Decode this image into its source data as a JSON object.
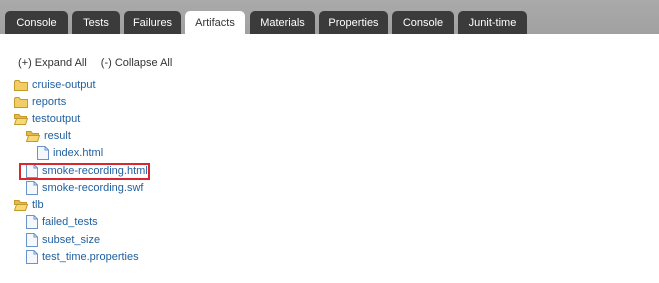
{
  "tabs": [
    {
      "label": "Console",
      "active": false
    },
    {
      "label": "Tests",
      "active": false
    },
    {
      "label": "Failures",
      "active": false
    },
    {
      "label": "Artifacts",
      "active": true
    },
    {
      "label": "Materials",
      "active": false
    },
    {
      "label": "Properties",
      "active": false
    },
    {
      "label": "Console",
      "active": false
    },
    {
      "label": "Junit-time",
      "active": false
    }
  ],
  "toolbar": {
    "expand_all": "(+) Expand All",
    "collapse_all": "(-) Collapse All"
  },
  "tree": [
    {
      "label": "cruise-output",
      "type": "folder",
      "expanded": false,
      "depth": 0
    },
    {
      "label": "reports",
      "type": "folder",
      "expanded": false,
      "depth": 0
    },
    {
      "label": "testoutput",
      "type": "folder",
      "expanded": true,
      "depth": 0
    },
    {
      "label": "result",
      "type": "folder",
      "expanded": true,
      "depth": 1
    },
    {
      "label": "index.html",
      "type": "file",
      "depth": 2
    },
    {
      "label": "smoke-recording.html",
      "type": "file",
      "depth": 1,
      "highlighted": true
    },
    {
      "label": "smoke-recording.swf",
      "type": "file",
      "depth": 1
    },
    {
      "label": "tlb",
      "type": "folder",
      "expanded": true,
      "depth": 0
    },
    {
      "label": "failed_tests",
      "type": "file",
      "depth": 1
    },
    {
      "label": "subset_size",
      "type": "file",
      "depth": 1
    },
    {
      "label": "test_time.properties",
      "type": "file",
      "depth": 1
    }
  ],
  "colors": {
    "tab_bg": "#3b3b3b",
    "tab_active_bg": "#ffffff",
    "tabbar_bg": "#a6a6a6",
    "link": "#1f5f9e",
    "highlight_border": "#d8282e",
    "folder": "#f2cd63",
    "file_outline": "#6a93c7"
  },
  "icons": {
    "folder": "folder-icon",
    "folder_open": "folder-open-icon",
    "file": "file-icon"
  }
}
